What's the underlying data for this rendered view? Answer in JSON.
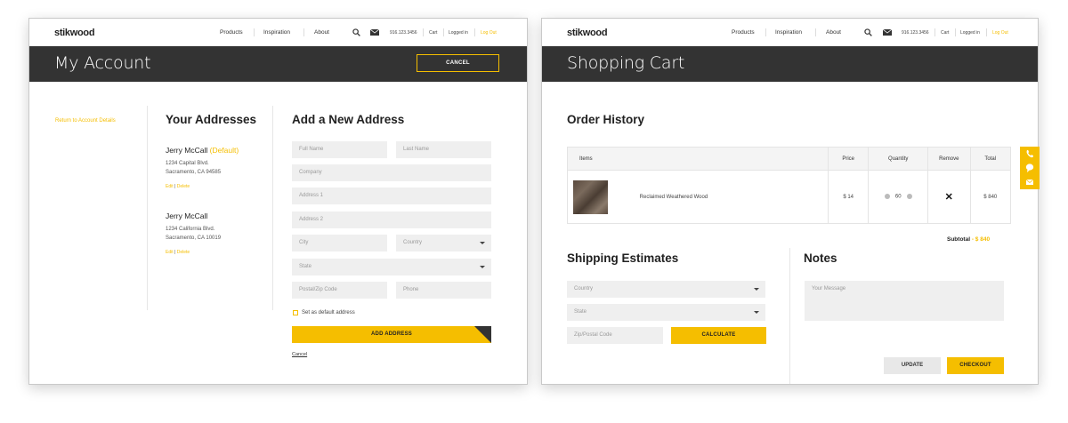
{
  "nav": {
    "logo": "stikwood",
    "links": [
      "Products",
      "Inspiration",
      "About"
    ],
    "phone": "916.123.3456",
    "cart": "Cart",
    "logged_in": "Logged in",
    "logout": "Log Out"
  },
  "account": {
    "title": "My Account",
    "cancel": "CANCEL",
    "return_link": "Return to Account Details",
    "addresses_heading": "Your Addresses",
    "addresses": [
      {
        "name": "Jerry McCall",
        "default_tag": "(Default)",
        "line1": "1234 Capital Blvd.",
        "line2": "Sacramento, CA 94585",
        "edit": "Edit",
        "delete": "Delete"
      },
      {
        "name": "Jerry McCall",
        "default_tag": "",
        "line1": "1234 California Blvd.",
        "line2": "Sacramento, CA 10019",
        "edit": "Edit",
        "delete": "Delete"
      }
    ],
    "link_sep": "|",
    "new_heading": "Add a New Address",
    "placeholders": {
      "first_name": "Full Name",
      "last_name": "Last Name",
      "company": "Company",
      "address1": "Address 1",
      "address2": "Address 2",
      "city": "City",
      "country": "Country",
      "state": "State",
      "zip": "Postal/Zip Code",
      "phone": "Phone"
    },
    "default_checkbox": "Set as default address",
    "add_button": "ADD ADDRESS",
    "cancel_link": "Cancel"
  },
  "cart": {
    "title": "Shopping Cart",
    "order_heading": "Order History",
    "columns": [
      "Items",
      "Price",
      "Quantity",
      "Remove",
      "Total"
    ],
    "rows": [
      {
        "item": "Reclaimed Weathered Wood",
        "price": "$ 14",
        "quantity": "60",
        "remove": "✕",
        "total": "$ 840"
      }
    ],
    "subtotal_label": "Subtotal",
    "subtotal_sep": "-",
    "subtotal_value": "$ 840",
    "shipping_heading": "Shipping Estimates",
    "country_placeholder": "Country",
    "state_placeholder": "State",
    "zip_placeholder": "Zip/Postal Code",
    "calculate": "CALCULATE",
    "notes_heading": "Notes",
    "notes_placeholder": "Your Message",
    "update": "UPDATE",
    "checkout": "CHECKOUT"
  },
  "side_tabs": [
    "phone-icon",
    "chat-icon",
    "mail-icon"
  ],
  "colors": {
    "accent": "#f5be00",
    "dark": "#333333",
    "field": "#efefef"
  }
}
